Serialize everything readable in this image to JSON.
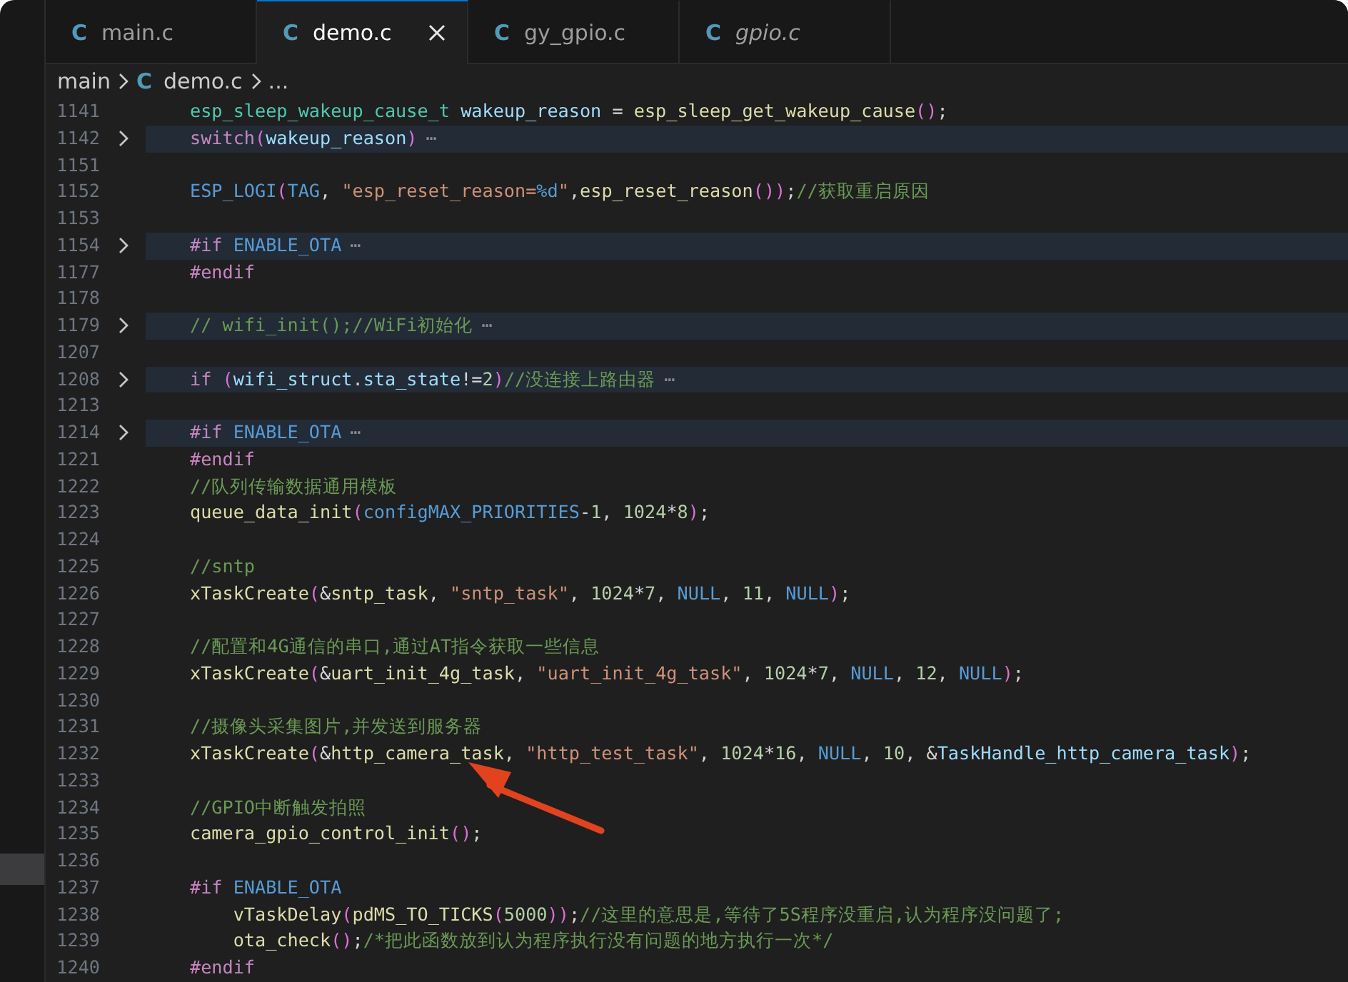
{
  "tabs": [
    {
      "icon": "C",
      "label": "main.c",
      "selected": false,
      "preview": false
    },
    {
      "icon": "C",
      "label": "demo.c",
      "selected": true,
      "preview": false
    },
    {
      "icon": "C",
      "label": "gy_gpio.c",
      "selected": false,
      "preview": false
    },
    {
      "icon": "C",
      "label": "gpio.c",
      "selected": false,
      "preview": true
    }
  ],
  "breadcrumb": [
    {
      "label": "main"
    },
    {
      "icon": "C",
      "label": "demo.c"
    },
    {
      "label": "..."
    }
  ],
  "lines": [
    {
      "number": "1141",
      "collapsed": false,
      "tokens": [
        {
          "text": "esp_sleep_wakeup_cause_t",
          "kind": "type"
        },
        {
          "text": " wakeup_reason",
          "kind": "var"
        },
        {
          "text": " = ",
          "kind": "punc"
        },
        {
          "text": "esp_sleep_get_wakeup_cause",
          "kind": "fn"
        },
        {
          "text": "()",
          "kind": "paren"
        },
        {
          "text": ";",
          "kind": "punc"
        }
      ]
    },
    {
      "number": "1142",
      "collapsed": true,
      "tokens": [
        {
          "text": "switch",
          "kind": "kw"
        },
        {
          "text": "(",
          "kind": "paren"
        },
        {
          "text": "wakeup_reason",
          "kind": "var"
        },
        {
          "text": ")",
          "kind": "paren"
        },
        {
          "text": "⋯",
          "kind": "fold"
        }
      ]
    },
    {
      "number": "1151"
    },
    {
      "number": "1152",
      "collapsed": false,
      "tokens": [
        {
          "text": "ESP_LOGI",
          "kind": "macro"
        },
        {
          "text": "(",
          "kind": "paren"
        },
        {
          "text": "TAG",
          "kind": "macro"
        },
        {
          "text": ", ",
          "kind": "punc"
        },
        {
          "text": "\"esp_reset_reason=",
          "kind": "str"
        },
        {
          "text": "%d",
          "kind": "macro"
        },
        {
          "text": "\"",
          "kind": "str"
        },
        {
          "text": ",",
          "kind": "punc"
        },
        {
          "text": "esp_reset_reason",
          "kind": "fn"
        },
        {
          "text": "())",
          "kind": "paren"
        },
        {
          "text": ";",
          "kind": "punc"
        },
        {
          "text": "//获取重启原因",
          "kind": "comment"
        }
      ]
    },
    {
      "number": "1153"
    },
    {
      "number": "1154",
      "collapsed": true,
      "tokens": [
        {
          "text": "#if",
          "kind": "kw"
        },
        {
          "text": " ENABLE_OTA",
          "kind": "macro"
        },
        {
          "text": "⋯",
          "kind": "fold"
        }
      ]
    },
    {
      "number": "1177",
      "collapsed": false,
      "tokens": [
        {
          "text": "#endif",
          "kind": "kw"
        }
      ]
    },
    {
      "number": "1178"
    },
    {
      "number": "1179",
      "collapsed": true,
      "tokens": [
        {
          "text": "// wifi_init();//WiFi初始化",
          "kind": "comment"
        },
        {
          "text": "⋯",
          "kind": "fold"
        }
      ]
    },
    {
      "number": "1207"
    },
    {
      "number": "1208",
      "collapsed": true,
      "tokens": [
        {
          "text": "if",
          "kind": "kw"
        },
        {
          "text": " (",
          "kind": "paren"
        },
        {
          "text": "wifi_struct",
          "kind": "var"
        },
        {
          "text": ".",
          "kind": "punc"
        },
        {
          "text": "sta_state",
          "kind": "var"
        },
        {
          "text": "!=",
          "kind": "punc"
        },
        {
          "text": "2",
          "kind": "num"
        },
        {
          "text": ")",
          "kind": "paren"
        },
        {
          "text": "//没连接上路由器",
          "kind": "comment"
        },
        {
          "text": "⋯",
          "kind": "fold"
        }
      ]
    },
    {
      "number": "1213"
    },
    {
      "number": "1214",
      "collapsed": true,
      "tokens": [
        {
          "text": "#if",
          "kind": "kw"
        },
        {
          "text": " ENABLE_OTA",
          "kind": "macro"
        },
        {
          "text": "⋯",
          "kind": "fold"
        }
      ]
    },
    {
      "number": "1221",
      "collapsed": false,
      "tokens": [
        {
          "text": "#endif",
          "kind": "kw"
        }
      ]
    },
    {
      "number": "1222",
      "collapsed": false,
      "tokens": [
        {
          "text": "//队列传输数据通用模板",
          "kind": "comment"
        }
      ]
    },
    {
      "number": "1223",
      "collapsed": false,
      "tokens": [
        {
          "text": "queue_data_init",
          "kind": "fn"
        },
        {
          "text": "(",
          "kind": "paren"
        },
        {
          "text": "configMAX_PRIORITIES",
          "kind": "macro"
        },
        {
          "text": "-",
          "kind": "punc"
        },
        {
          "text": "1",
          "kind": "num"
        },
        {
          "text": ", ",
          "kind": "punc"
        },
        {
          "text": "1024",
          "kind": "num"
        },
        {
          "text": "*",
          "kind": "punc"
        },
        {
          "text": "8",
          "kind": "num"
        },
        {
          "text": ")",
          "kind": "paren"
        },
        {
          "text": ";",
          "kind": "punc"
        }
      ]
    },
    {
      "number": "1224"
    },
    {
      "number": "1225",
      "collapsed": false,
      "tokens": [
        {
          "text": "//sntp",
          "kind": "comment"
        }
      ]
    },
    {
      "number": "1226",
      "collapsed": false,
      "tokens": [
        {
          "text": "xTaskCreate",
          "kind": "fn"
        },
        {
          "text": "(",
          "kind": "paren"
        },
        {
          "text": "&",
          "kind": "punc"
        },
        {
          "text": "sntp_task",
          "kind": "fn"
        },
        {
          "text": ", ",
          "kind": "punc"
        },
        {
          "text": "\"sntp_task\"",
          "kind": "str"
        },
        {
          "text": ", ",
          "kind": "punc"
        },
        {
          "text": "1024",
          "kind": "num"
        },
        {
          "text": "*",
          "kind": "punc"
        },
        {
          "text": "7",
          "kind": "num"
        },
        {
          "text": ", ",
          "kind": "punc"
        },
        {
          "text": "NULL",
          "kind": "macro"
        },
        {
          "text": ", ",
          "kind": "punc"
        },
        {
          "text": "11",
          "kind": "num"
        },
        {
          "text": ", ",
          "kind": "punc"
        },
        {
          "text": "NULL",
          "kind": "macro"
        },
        {
          "text": ")",
          "kind": "paren"
        },
        {
          "text": ";",
          "kind": "punc"
        }
      ]
    },
    {
      "number": "1227"
    },
    {
      "number": "1228",
      "collapsed": false,
      "tokens": [
        {
          "text": "//配置和4G通信的串口,通过AT指令获取一些信息",
          "kind": "comment"
        }
      ]
    },
    {
      "number": "1229",
      "collapsed": false,
      "tokens": [
        {
          "text": "xTaskCreate",
          "kind": "fn"
        },
        {
          "text": "(",
          "kind": "paren"
        },
        {
          "text": "&",
          "kind": "punc"
        },
        {
          "text": "uart_init_4g_task",
          "kind": "fn"
        },
        {
          "text": ", ",
          "kind": "punc"
        },
        {
          "text": "\"uart_init_4g_task\"",
          "kind": "str"
        },
        {
          "text": ", ",
          "kind": "punc"
        },
        {
          "text": "1024",
          "kind": "num"
        },
        {
          "text": "*",
          "kind": "punc"
        },
        {
          "text": "7",
          "kind": "num"
        },
        {
          "text": ", ",
          "kind": "punc"
        },
        {
          "text": "NULL",
          "kind": "macro"
        },
        {
          "text": ", ",
          "kind": "punc"
        },
        {
          "text": "12",
          "kind": "num"
        },
        {
          "text": ", ",
          "kind": "punc"
        },
        {
          "text": "NULL",
          "kind": "macro"
        },
        {
          "text": ")",
          "kind": "paren"
        },
        {
          "text": ";",
          "kind": "punc"
        }
      ]
    },
    {
      "number": "1230"
    },
    {
      "number": "1231",
      "collapsed": false,
      "tokens": [
        {
          "text": "//摄像头采集图片,并发送到服务器",
          "kind": "comment"
        }
      ]
    },
    {
      "number": "1232",
      "collapsed": false,
      "tokens": [
        {
          "text": "xTaskCreate",
          "kind": "fn"
        },
        {
          "text": "(",
          "kind": "paren"
        },
        {
          "text": "&",
          "kind": "punc"
        },
        {
          "text": "http_camera_task",
          "kind": "fn"
        },
        {
          "text": ", ",
          "kind": "punc"
        },
        {
          "text": "\"http_test_task\"",
          "kind": "str"
        },
        {
          "text": ", ",
          "kind": "punc"
        },
        {
          "text": "1024",
          "kind": "num"
        },
        {
          "text": "*",
          "kind": "punc"
        },
        {
          "text": "16",
          "kind": "num"
        },
        {
          "text": ", ",
          "kind": "punc"
        },
        {
          "text": "NULL",
          "kind": "macro"
        },
        {
          "text": ", ",
          "kind": "punc"
        },
        {
          "text": "10",
          "kind": "num"
        },
        {
          "text": ", ",
          "kind": "punc"
        },
        {
          "text": "&",
          "kind": "punc"
        },
        {
          "text": "TaskHandle_http_camera_task",
          "kind": "var"
        },
        {
          "text": ")",
          "kind": "paren"
        },
        {
          "text": ";",
          "kind": "punc"
        }
      ]
    },
    {
      "number": "1233"
    },
    {
      "number": "1234",
      "collapsed": false,
      "tokens": [
        {
          "text": "//GPIO中断触发拍照",
          "kind": "comment"
        }
      ]
    },
    {
      "number": "1235",
      "collapsed": false,
      "tokens": [
        {
          "text": "camera_gpio_control_init",
          "kind": "fn"
        },
        {
          "text": "()",
          "kind": "paren"
        },
        {
          "text": ";",
          "kind": "punc"
        }
      ]
    },
    {
      "number": "1236"
    },
    {
      "number": "1237",
      "collapsed": false,
      "tokens": [
        {
          "text": "#if",
          "kind": "kw"
        },
        {
          "text": " ENABLE_OTA",
          "kind": "macro"
        }
      ]
    },
    {
      "number": "1238",
      "collapsed": false,
      "tokens": [
        {
          "text": "    vTaskDelay",
          "kind": "fn"
        },
        {
          "text": "(",
          "kind": "paren"
        },
        {
          "text": "pdMS_TO_TICKS",
          "kind": "fn"
        },
        {
          "text": "(",
          "kind": "paren"
        },
        {
          "text": "5000",
          "kind": "num"
        },
        {
          "text": "))",
          "kind": "paren"
        },
        {
          "text": ";",
          "kind": "punc"
        },
        {
          "text": "//这里的意思是,等待了5S程序没重启,认为程序没问题了;",
          "kind": "comment"
        }
      ]
    },
    {
      "number": "1239",
      "collapsed": false,
      "tokens": [
        {
          "text": "    ota_check",
          "kind": "fn"
        },
        {
          "text": "()",
          "kind": "paren"
        },
        {
          "text": ";",
          "kind": "punc"
        },
        {
          "text": "/*把此函数放到认为程序执行没有问题的地方执行一次*/",
          "kind": "comment"
        }
      ]
    },
    {
      "number": "1240",
      "collapsed": false,
      "tokens": [
        {
          "text": "#endif",
          "kind": "kw"
        }
      ]
    }
  ]
}
